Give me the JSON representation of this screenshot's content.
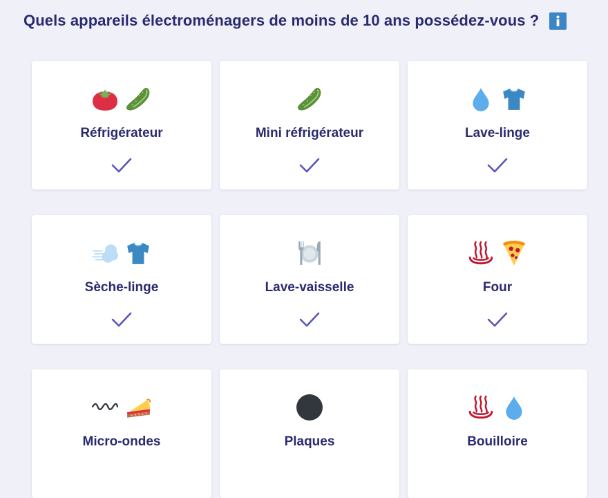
{
  "question": {
    "text": "Quels appareils électroménagers de moins de 10 ans possédez-vous ?",
    "info_icon": "info-icon"
  },
  "colors": {
    "background": "#eff0f8",
    "text": "#2a2b6e",
    "check": "#5a56b8",
    "info": "#3d86c6"
  },
  "options": [
    {
      "label": "Réfrigérateur",
      "icons": [
        "tomato-icon",
        "cucumber-icon"
      ],
      "selected": true
    },
    {
      "label": "Mini réfrigérateur",
      "icons": [
        "cucumber-icon"
      ],
      "selected": true
    },
    {
      "label": "Lave-linge",
      "icons": [
        "droplet-icon",
        "tshirt-icon"
      ],
      "selected": true
    },
    {
      "label": "Sèche-linge",
      "icons": [
        "wind-icon",
        "tshirt-icon"
      ],
      "selected": true
    },
    {
      "label": "Lave-vaisselle",
      "icons": [
        "plate-cutlery-icon"
      ],
      "selected": true
    },
    {
      "label": "Four",
      "icons": [
        "hot-springs-icon",
        "pizza-icon"
      ],
      "selected": true
    },
    {
      "label": "Micro-ondes",
      "icons": [
        "wave-icon",
        "pie-icon"
      ],
      "selected": false
    },
    {
      "label": "Plaques",
      "icons": [
        "black-circle-icon"
      ],
      "selected": false
    },
    {
      "label": "Bouilloire",
      "icons": [
        "hot-springs-icon",
        "droplet-icon"
      ],
      "selected": false
    }
  ]
}
